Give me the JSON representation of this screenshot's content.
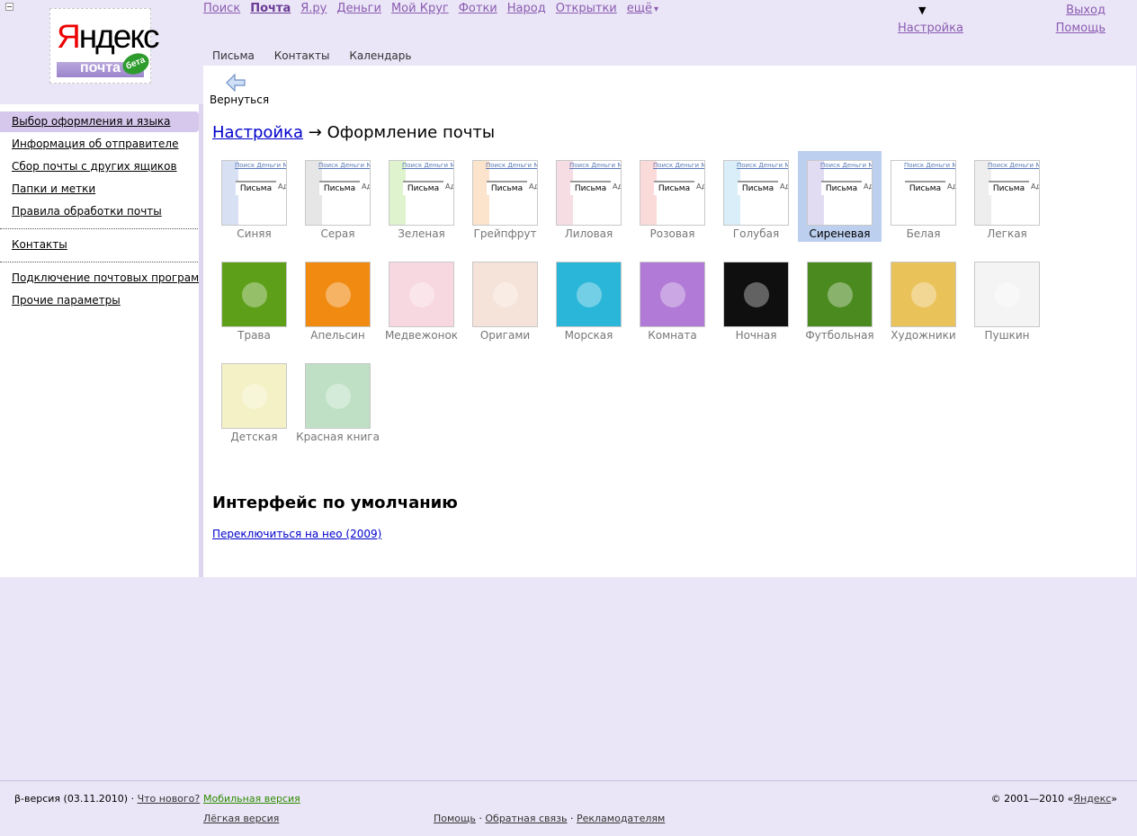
{
  "header": {
    "logo_word": "Яндекс",
    "logo_sub": "почта",
    "logo_badge": "бета",
    "services": [
      {
        "label": "Поиск",
        "current": false
      },
      {
        "label": "Почта",
        "current": true
      },
      {
        "label": "Я.ру",
        "current": false
      },
      {
        "label": "Деньги",
        "current": false
      },
      {
        "label": "Мой Круг",
        "current": false
      },
      {
        "label": "Фотки",
        "current": false
      },
      {
        "label": "Народ",
        "current": false
      },
      {
        "label": "Открытки",
        "current": false
      },
      {
        "label": "ещё",
        "current": false
      }
    ],
    "more_caret": "▾",
    "settings_arrow": "▼",
    "settings": "Настройка",
    "logout": "Выход",
    "help": "Помощь"
  },
  "subtabs": [
    "Письма",
    "Контакты",
    "Календарь"
  ],
  "sidebar": {
    "items": [
      {
        "label": "Выбор оформления и языка",
        "active": true
      },
      {
        "label": "Информация об отправителе"
      },
      {
        "label": "Сбор почты с других ящиков"
      },
      {
        "label": "Папки и метки"
      },
      {
        "label": "Правила обработки почты"
      },
      {
        "label": "Контакты"
      },
      {
        "label": "Подключение почтовых программ"
      },
      {
        "label": "Прочие параметры"
      }
    ]
  },
  "main": {
    "back_label": "Вернуться",
    "breadcrumb_link": "Настройка",
    "breadcrumb_arrow": "→",
    "breadcrumb_current": "Оформление почты",
    "themes": [
      {
        "label": "Синяя",
        "kind": "ui",
        "accent": "#d8e0f4",
        "selected": false
      },
      {
        "label": "Серая",
        "kind": "ui",
        "accent": "#e6e6e6",
        "selected": false
      },
      {
        "label": "Зеленая",
        "kind": "ui",
        "accent": "#dff3cf",
        "selected": false
      },
      {
        "label": "Грейпфрут",
        "kind": "ui",
        "accent": "#fbe3cc",
        "selected": false
      },
      {
        "label": "Лиловая",
        "kind": "ui",
        "accent": "#f6dde4",
        "selected": false
      },
      {
        "label": "Розовая",
        "kind": "ui",
        "accent": "#fbdada",
        "selected": false
      },
      {
        "label": "Голубая",
        "kind": "ui",
        "accent": "#d9eef9",
        "selected": false
      },
      {
        "label": "Сиреневая",
        "kind": "ui",
        "accent": "#e2dcf3",
        "selected": true
      },
      {
        "label": "Белая",
        "kind": "ui",
        "accent": "#ffffff",
        "selected": false
      },
      {
        "label": "Легкая",
        "kind": "ui",
        "accent": "#eeeeee",
        "selected": false
      },
      {
        "label": "Трава",
        "kind": "pic",
        "bg": "#5d9f19",
        "selected": false
      },
      {
        "label": "Апельсин",
        "kind": "pic",
        "bg": "#f08a10",
        "selected": false
      },
      {
        "label": "Медвежонок",
        "kind": "pic",
        "bg": "#f8d8e0",
        "selected": false
      },
      {
        "label": "Оригами",
        "kind": "pic",
        "bg": "#f5e2d8",
        "selected": false
      },
      {
        "label": "Морская",
        "kind": "pic",
        "bg": "#29b6d8",
        "selected": false
      },
      {
        "label": "Комната",
        "kind": "pic",
        "bg": "#b07ad6",
        "selected": false
      },
      {
        "label": "Ночная",
        "kind": "pic",
        "bg": "#0f0f0f",
        "selected": false
      },
      {
        "label": "Футбольная",
        "kind": "pic",
        "bg": "#4b8a1e",
        "selected": false
      },
      {
        "label": "Художники",
        "kind": "pic",
        "bg": "#eac25a",
        "selected": false
      },
      {
        "label": "Пушкин",
        "kind": "pic",
        "bg": "#f4f4f4",
        "selected": false
      },
      {
        "label": "Детская",
        "kind": "pic",
        "bg": "#f3f1c5",
        "selected": false
      },
      {
        "label": "Красная книга",
        "kind": "pic",
        "bg": "#bfe0c5",
        "selected": false
      }
    ],
    "mini_links": "Поиск Деньги М",
    "mini_tab": "Письма",
    "mini_adr": "Ад",
    "default_heading": "Интерфейс по умолчанию",
    "switch_link": "Переключиться на нео (2009)"
  },
  "footer": {
    "version": "β-версия (03.11.2010) ·",
    "whats_new": "Что нового?",
    "mobile": "Мобильная версия",
    "light": "Лёгкая версия",
    "help": "Помощь",
    "feedback": "Обратная связь",
    "advertisers": "Рекламодателям",
    "sep": "·",
    "copyright_prefix": "©  2001—2010 «",
    "yandex": "Яндекс",
    "copyright_suffix": "»"
  }
}
